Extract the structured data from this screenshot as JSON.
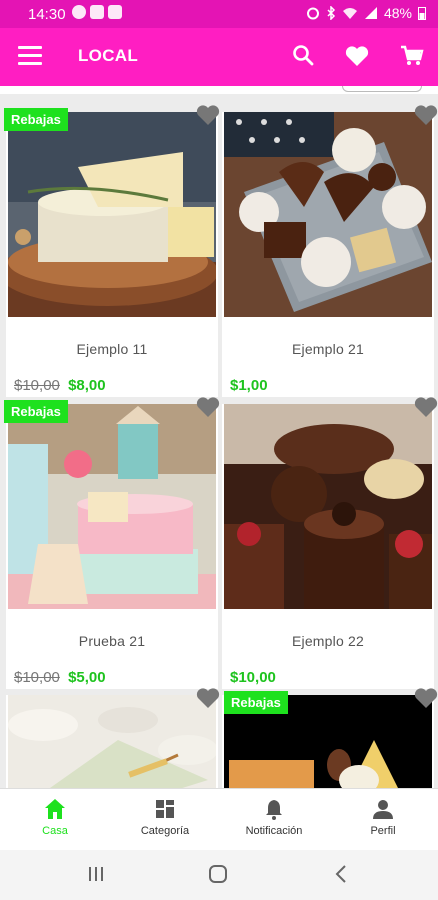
{
  "status": {
    "time": "14:30",
    "battery": "48%"
  },
  "appbar": {
    "title": "LOCAL"
  },
  "products": [
    {
      "name": "Ejemplo 11",
      "old_price": "$10,00",
      "price": "$8,00",
      "badge": "Rebajas"
    },
    {
      "name": "Ejemplo 21",
      "old_price": "",
      "price": "$1,00",
      "badge": ""
    },
    {
      "name": "Prueba 21",
      "old_price": "$10,00",
      "price": "$5,00",
      "badge": "Rebajas"
    },
    {
      "name": "Ejemplo 22",
      "old_price": "",
      "price": "$10,00",
      "badge": ""
    },
    {
      "name": "",
      "old_price": "",
      "price": "",
      "badge": ""
    },
    {
      "name": "",
      "old_price": "",
      "price": "",
      "badge": "Rebajas"
    }
  ],
  "bottomnav": {
    "home": "Casa",
    "category": "Categoría",
    "notifications": "Notificación",
    "profile": "Perfil"
  },
  "colors": {
    "primary": "#ff1ec2",
    "accent": "#1ee11e"
  }
}
